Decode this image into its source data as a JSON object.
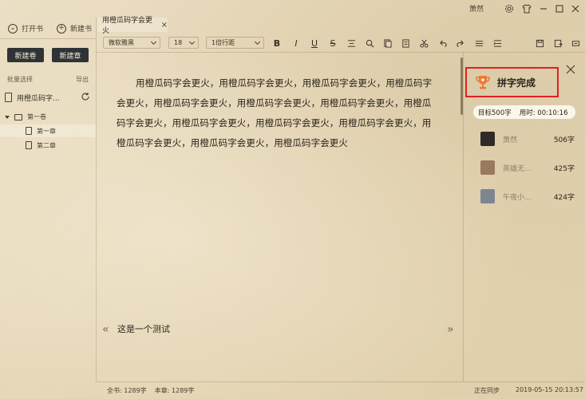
{
  "topbar": {
    "username": "萧然",
    "icons": [
      "gear-icon",
      "shirt-icon",
      "minimize-icon",
      "maximize-icon",
      "close-icon"
    ]
  },
  "sidebar": {
    "open_book": "打开书",
    "new_book": "新建书",
    "new_volume_btn": "新建卷",
    "new_chapter_btn": "新建章",
    "batch_select": "批量选择",
    "export": "导出",
    "book_title": "用橙瓜码字...",
    "volume": "第一卷",
    "chapters": [
      "第一章",
      "第二章"
    ]
  },
  "tab": {
    "title": "用橙瓜码字会更火",
    "close": "×"
  },
  "toolbar": {
    "font": "微软雅黑",
    "font_size": "18",
    "line_spacing": "1倍行距"
  },
  "editor": {
    "content": "用橙瓜码字会更火，用橙瓜码字会更火，用橙瓜码字会更火，用橙瓜码字会更火，用橙瓜码字会更火，用橙瓜码字会更火，用橙瓜码字会更火，用橙瓜码字会更火，用橙瓜码字会更火，用橙瓜码字会更火，用橙瓜码字会更火，用橙瓜码字会更火，用橙瓜码字会更火，用橙瓜码字会更火",
    "prev": "«",
    "next": "»",
    "note": "这是一个测试"
  },
  "panel": {
    "title": "拼字完成",
    "target": "目标500字",
    "time": "用时: 00:10:16",
    "ranking": [
      {
        "name": "萧然",
        "count": "506字",
        "color": "#2e2a28"
      },
      {
        "name": "英雄无...",
        "count": "425字",
        "color": "#9a7a5e"
      },
      {
        "name": "午夜小...",
        "count": "424字",
        "color": "#7d8690"
      }
    ]
  },
  "status": {
    "total": "全书: 1289字",
    "chapter": "本章: 1289字",
    "sync": "正在同步",
    "datetime": "2019-05-15 20:13:57"
  }
}
